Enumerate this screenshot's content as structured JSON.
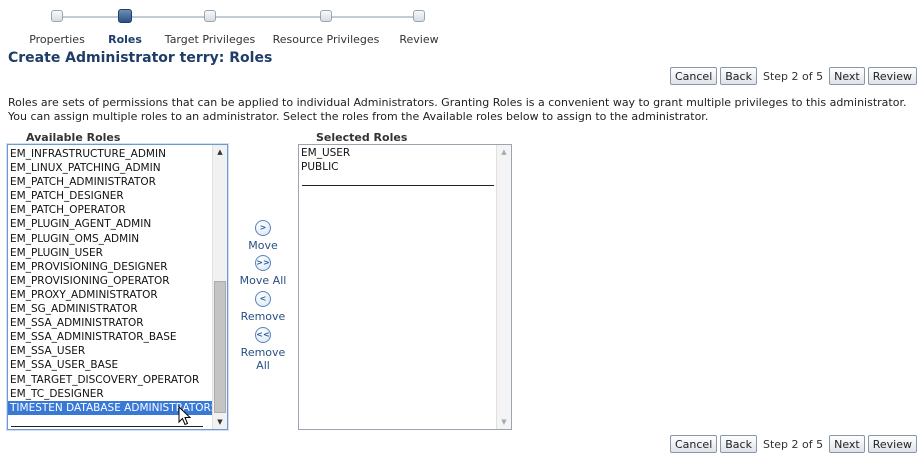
{
  "train": {
    "steps": [
      {
        "label": "Properties"
      },
      {
        "label": "Roles"
      },
      {
        "label": "Target Privileges"
      },
      {
        "label": "Resource Privileges"
      },
      {
        "label": "Review"
      }
    ],
    "current": "Roles"
  },
  "page": {
    "title": "Create Administrator terry: Roles"
  },
  "nav": {
    "cancel": "Cancel",
    "back": "Back",
    "step_text": "Step 2 of 5",
    "next": "Next",
    "review": "Review"
  },
  "description": "Roles are sets of permissions that can be applied to individual Administrators. Granting Roles is a convenient way to grant multiple privileges to this administrator. You can assign multiple roles to an administrator. Select the roles from the Available roles below to assign to the administrator.",
  "available": {
    "header": "Available Roles",
    "items": [
      "EM_INFRASTRUCTURE_ADMIN",
      "EM_LINUX_PATCHING_ADMIN",
      "EM_PATCH_ADMINISTRATOR",
      "EM_PATCH_DESIGNER",
      "EM_PATCH_OPERATOR",
      "EM_PLUGIN_AGENT_ADMIN",
      "EM_PLUGIN_OMS_ADMIN",
      "EM_PLUGIN_USER",
      "EM_PROVISIONING_DESIGNER",
      "EM_PROVISIONING_OPERATOR",
      "EM_PROXY_ADMINISTRATOR",
      "EM_SG_ADMINISTRATOR",
      "EM_SSA_ADMINISTRATOR",
      "EM_SSA_ADMINISTRATOR_BASE",
      "EM_SSA_USER",
      "EM_SSA_USER_BASE",
      "EM_TARGET_DISCOVERY_OPERATOR",
      "EM_TC_DESIGNER",
      "TIMESTEN DATABASE ADMINISTRATORS"
    ],
    "selected_item": "TIMESTEN DATABASE ADMINISTRATORS"
  },
  "selected": {
    "header": "Selected Roles",
    "items": [
      "EM_USER",
      "PUBLIC"
    ]
  },
  "shuttle": {
    "move": "Move",
    "move_all": "Move All",
    "remove": "Remove",
    "remove_all": "Remove All",
    "move_icon": "chevron-right-icon",
    "move_all_icon": "double-chevron-right-icon",
    "remove_icon": "chevron-left-icon",
    "remove_all_icon": "double-chevron-left-icon"
  },
  "colors": {
    "title": "#1f3d66",
    "selection": "#3a78d6",
    "link": "#2a4f82"
  }
}
